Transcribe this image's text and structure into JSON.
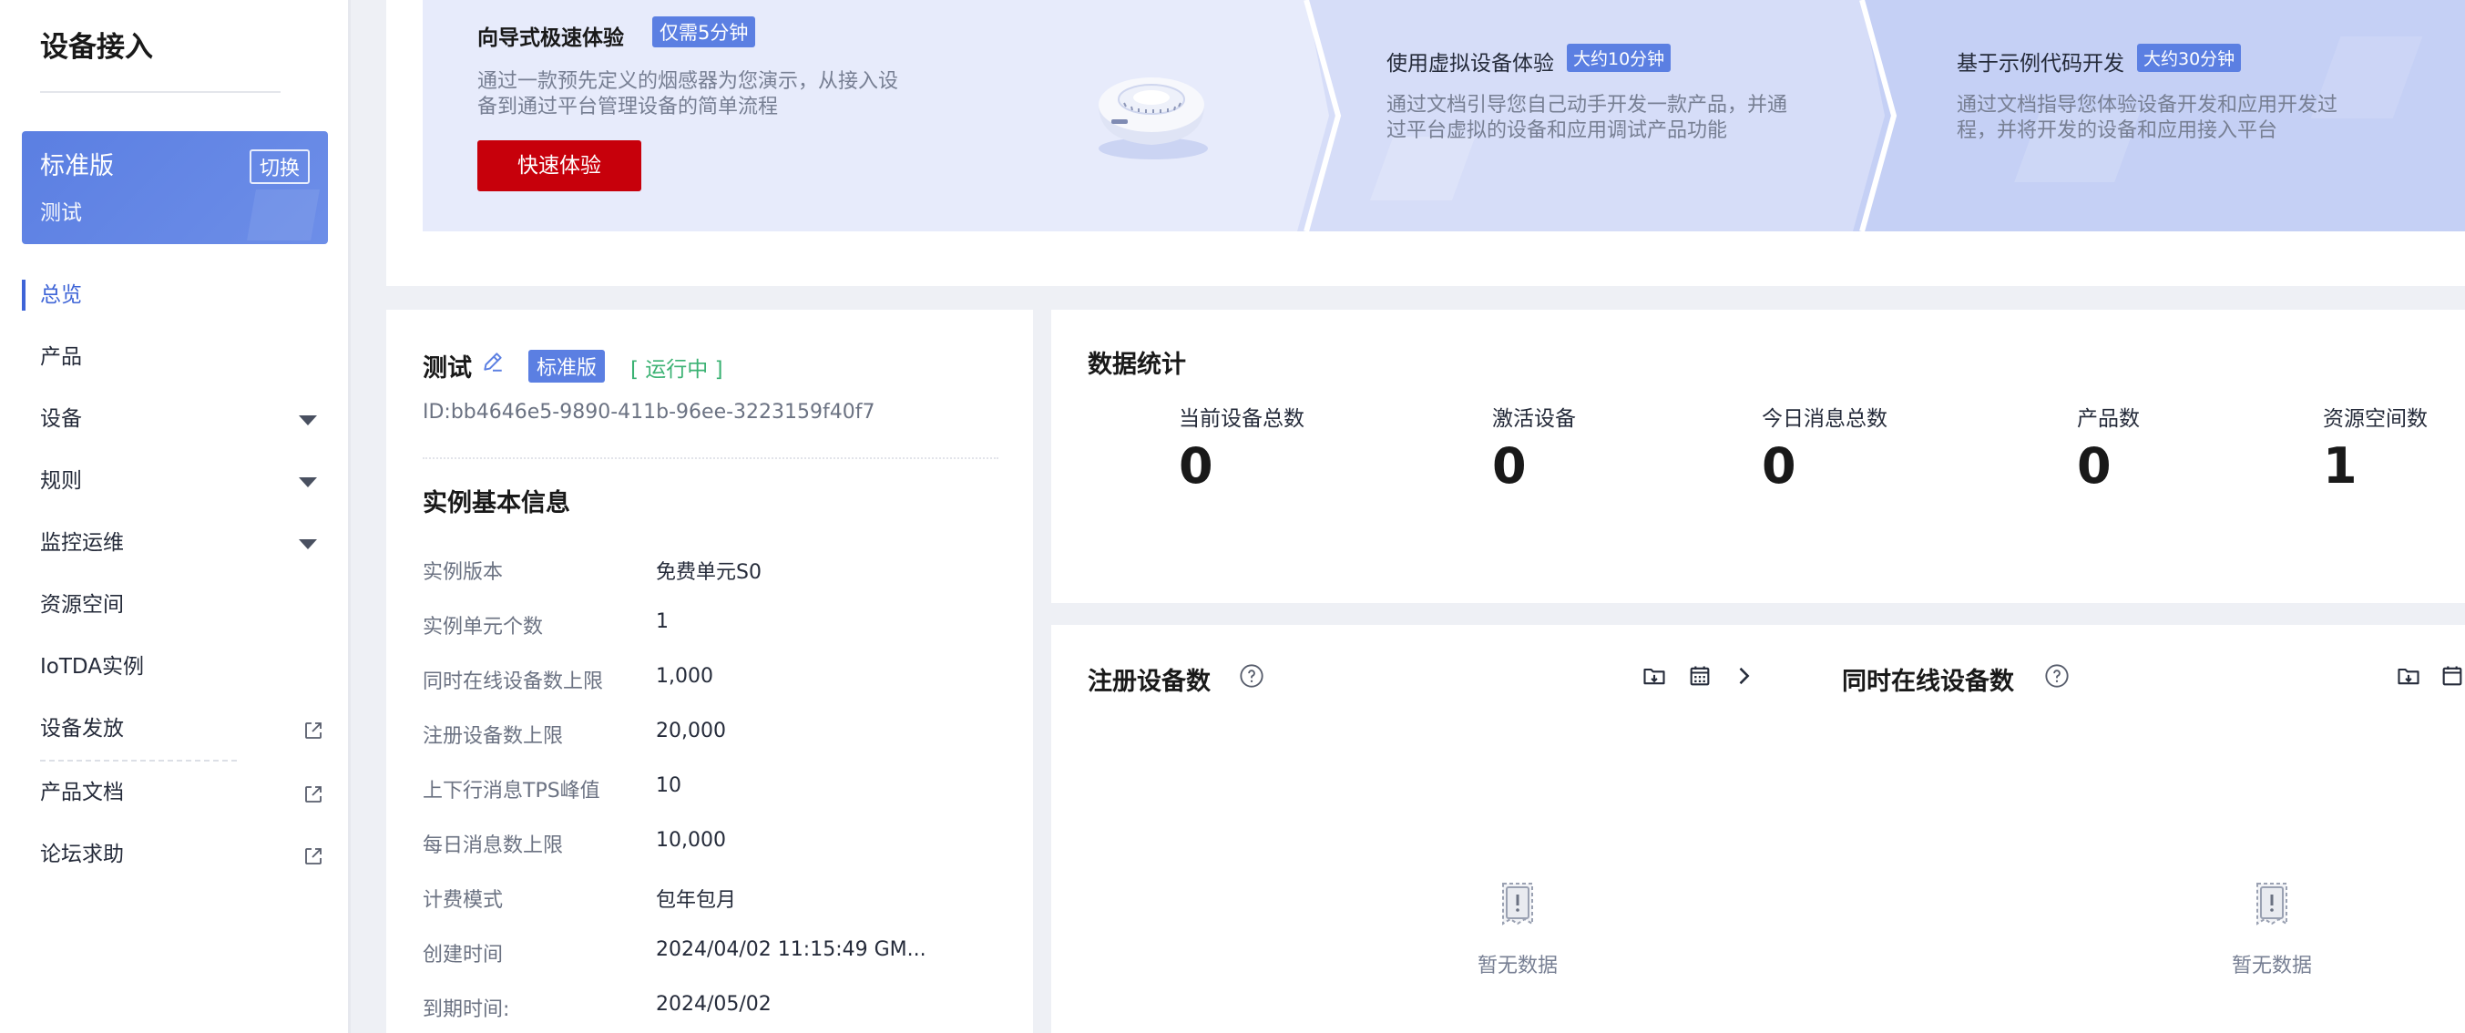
{
  "sidebar": {
    "title": "设备接入",
    "edition": {
      "name": "标准版",
      "switch_label": "切换",
      "instance": "测试"
    },
    "nav": [
      {
        "label": "总览",
        "active": true
      },
      {
        "label": "产品"
      },
      {
        "label": "设备",
        "arrow": true
      },
      {
        "label": "规则",
        "arrow": true
      },
      {
        "label": "监控运维",
        "arrow": true
      },
      {
        "label": "资源空间"
      },
      {
        "label": "IoTDA实例"
      },
      {
        "label": "设备发放",
        "external": true
      },
      {
        "label": "产品文档",
        "external": true
      },
      {
        "label": "论坛求助",
        "external": true
      }
    ]
  },
  "banner": {
    "wizard": {
      "title": "向导式极速体验",
      "badge": "仅需5分钟",
      "desc": [
        "通过一款预先定义的烟感器为您演示，从接入设",
        "备到通过平台管理设备的简单流程"
      ],
      "button": "快速体验"
    },
    "virtual": {
      "title": "使用虚拟设备体验",
      "badge": "大约10分钟",
      "desc": [
        "通过文档引导您自己动手开发一款产品，并通",
        "过平台虚拟的设备和应用调试产品功能"
      ]
    },
    "sample": {
      "title": "基于示例代码开发",
      "badge": "大约30分钟",
      "desc": [
        "通过文档指导您体验设备开发和应用开发过",
        "程，并将开发的设备和应用接入平台"
      ]
    }
  },
  "instance": {
    "name": "测试",
    "edition_badge": "标准版",
    "status": "[ 运行中 ]",
    "id": "ID:bb4646e5-9890-411b-96ee-3223159f40f7",
    "section_title": "实例基本信息",
    "rows": [
      {
        "k": "实例版本",
        "v": "免费单元S0"
      },
      {
        "k": "实例单元个数",
        "v": "1"
      },
      {
        "k": "同时在线设备数上限",
        "v": "1,000"
      },
      {
        "k": "注册设备数上限",
        "v": "20,000"
      },
      {
        "k": "上下行消息TPS峰值",
        "v": "10"
      },
      {
        "k": "每日消息数上限",
        "v": "10,000"
      },
      {
        "k": "计费模式",
        "v": "包年包月"
      },
      {
        "k": "创建时间",
        "v": "2024/04/02 11:15:49 GM..."
      },
      {
        "k": "到期时间:",
        "v": "2024/05/02"
      }
    ]
  },
  "stats": {
    "title": "数据统计",
    "items": [
      {
        "label": "当前设备总数",
        "value": "0"
      },
      {
        "label": "激活设备",
        "value": "0"
      },
      {
        "label": "今日消息总数",
        "value": "0"
      },
      {
        "label": "产品数",
        "value": "0"
      },
      {
        "label": "资源空间数",
        "value": "1"
      }
    ]
  },
  "charts": {
    "registered": {
      "title": "注册设备数",
      "empty": "暂无数据"
    },
    "online": {
      "title": "同时在线设备数",
      "empty": "暂无数据"
    }
  },
  "colors": {
    "accent": "#5b7fe2",
    "primary_button": "#c7000b",
    "running": "#3bb273",
    "active_nav": "#3e64d7"
  }
}
